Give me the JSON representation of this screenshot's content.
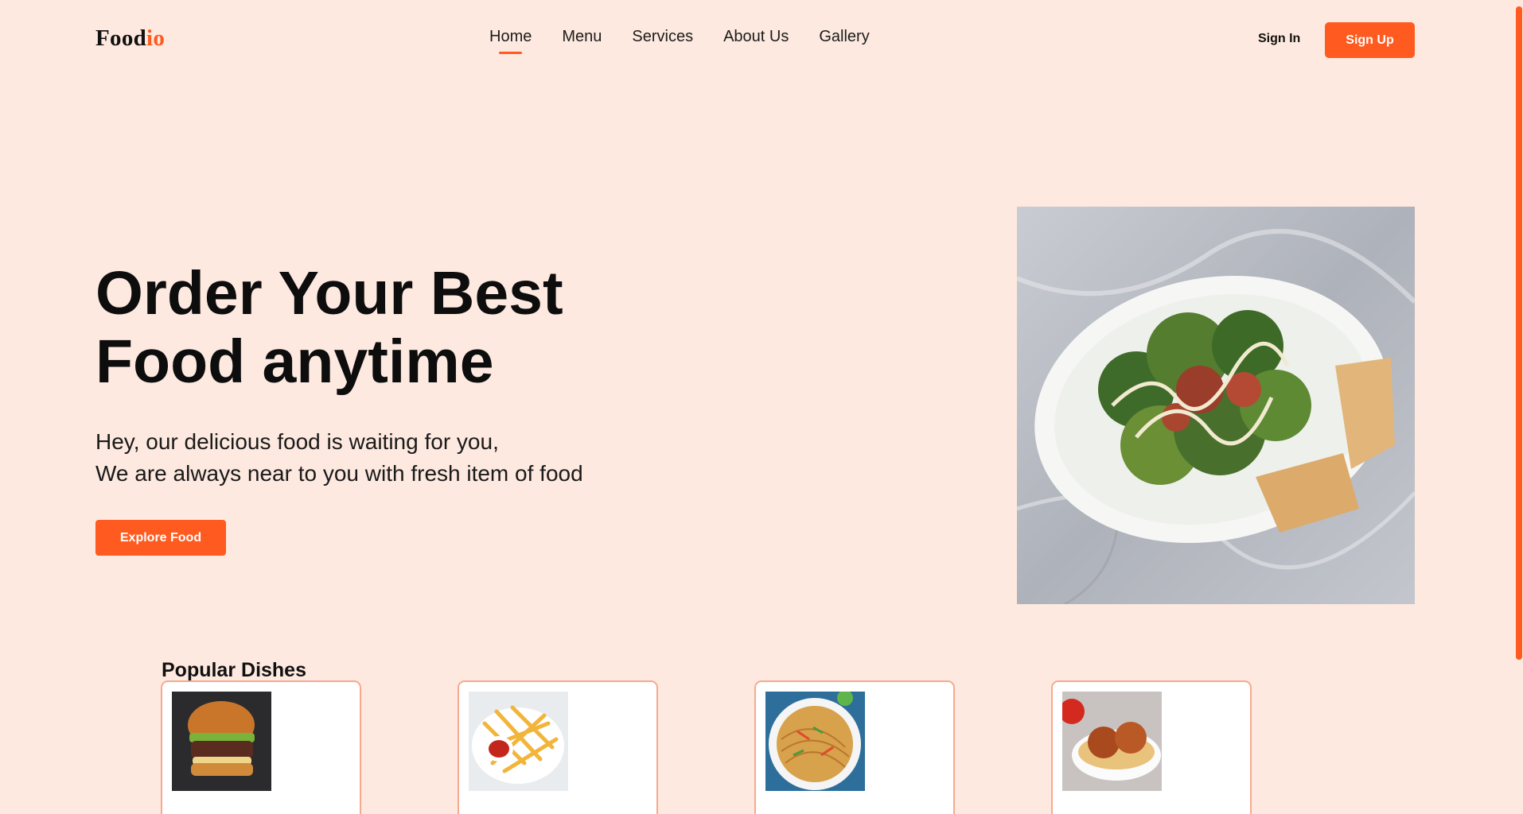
{
  "logo": {
    "main": "Food",
    "accent": "io"
  },
  "nav": [
    {
      "label": "Home",
      "active": true
    },
    {
      "label": "Menu"
    },
    {
      "label": "Services"
    },
    {
      "label": "About Us"
    },
    {
      "label": "Gallery"
    }
  ],
  "auth": {
    "signin": "Sign In",
    "signup": "Sign Up"
  },
  "hero": {
    "title_line1": "Order Your Best",
    "title_line2": "Food anytime",
    "sub_line1": "Hey, our delicious food is waiting for you,",
    "sub_line2": "We are always near to you with fresh item of food",
    "cta": "Explore Food",
    "image": "salad-photo"
  },
  "popular": {
    "title": "Popular Dishes",
    "dishes": [
      {
        "image": "burger-photo"
      },
      {
        "image": "fries-photo"
      },
      {
        "image": "noodles-photo"
      },
      {
        "image": "gulab-jamun-photo"
      }
    ]
  },
  "colors": {
    "accent": "#ff5a1f",
    "background": "#fde9df",
    "card_border": "#f7a98f"
  }
}
